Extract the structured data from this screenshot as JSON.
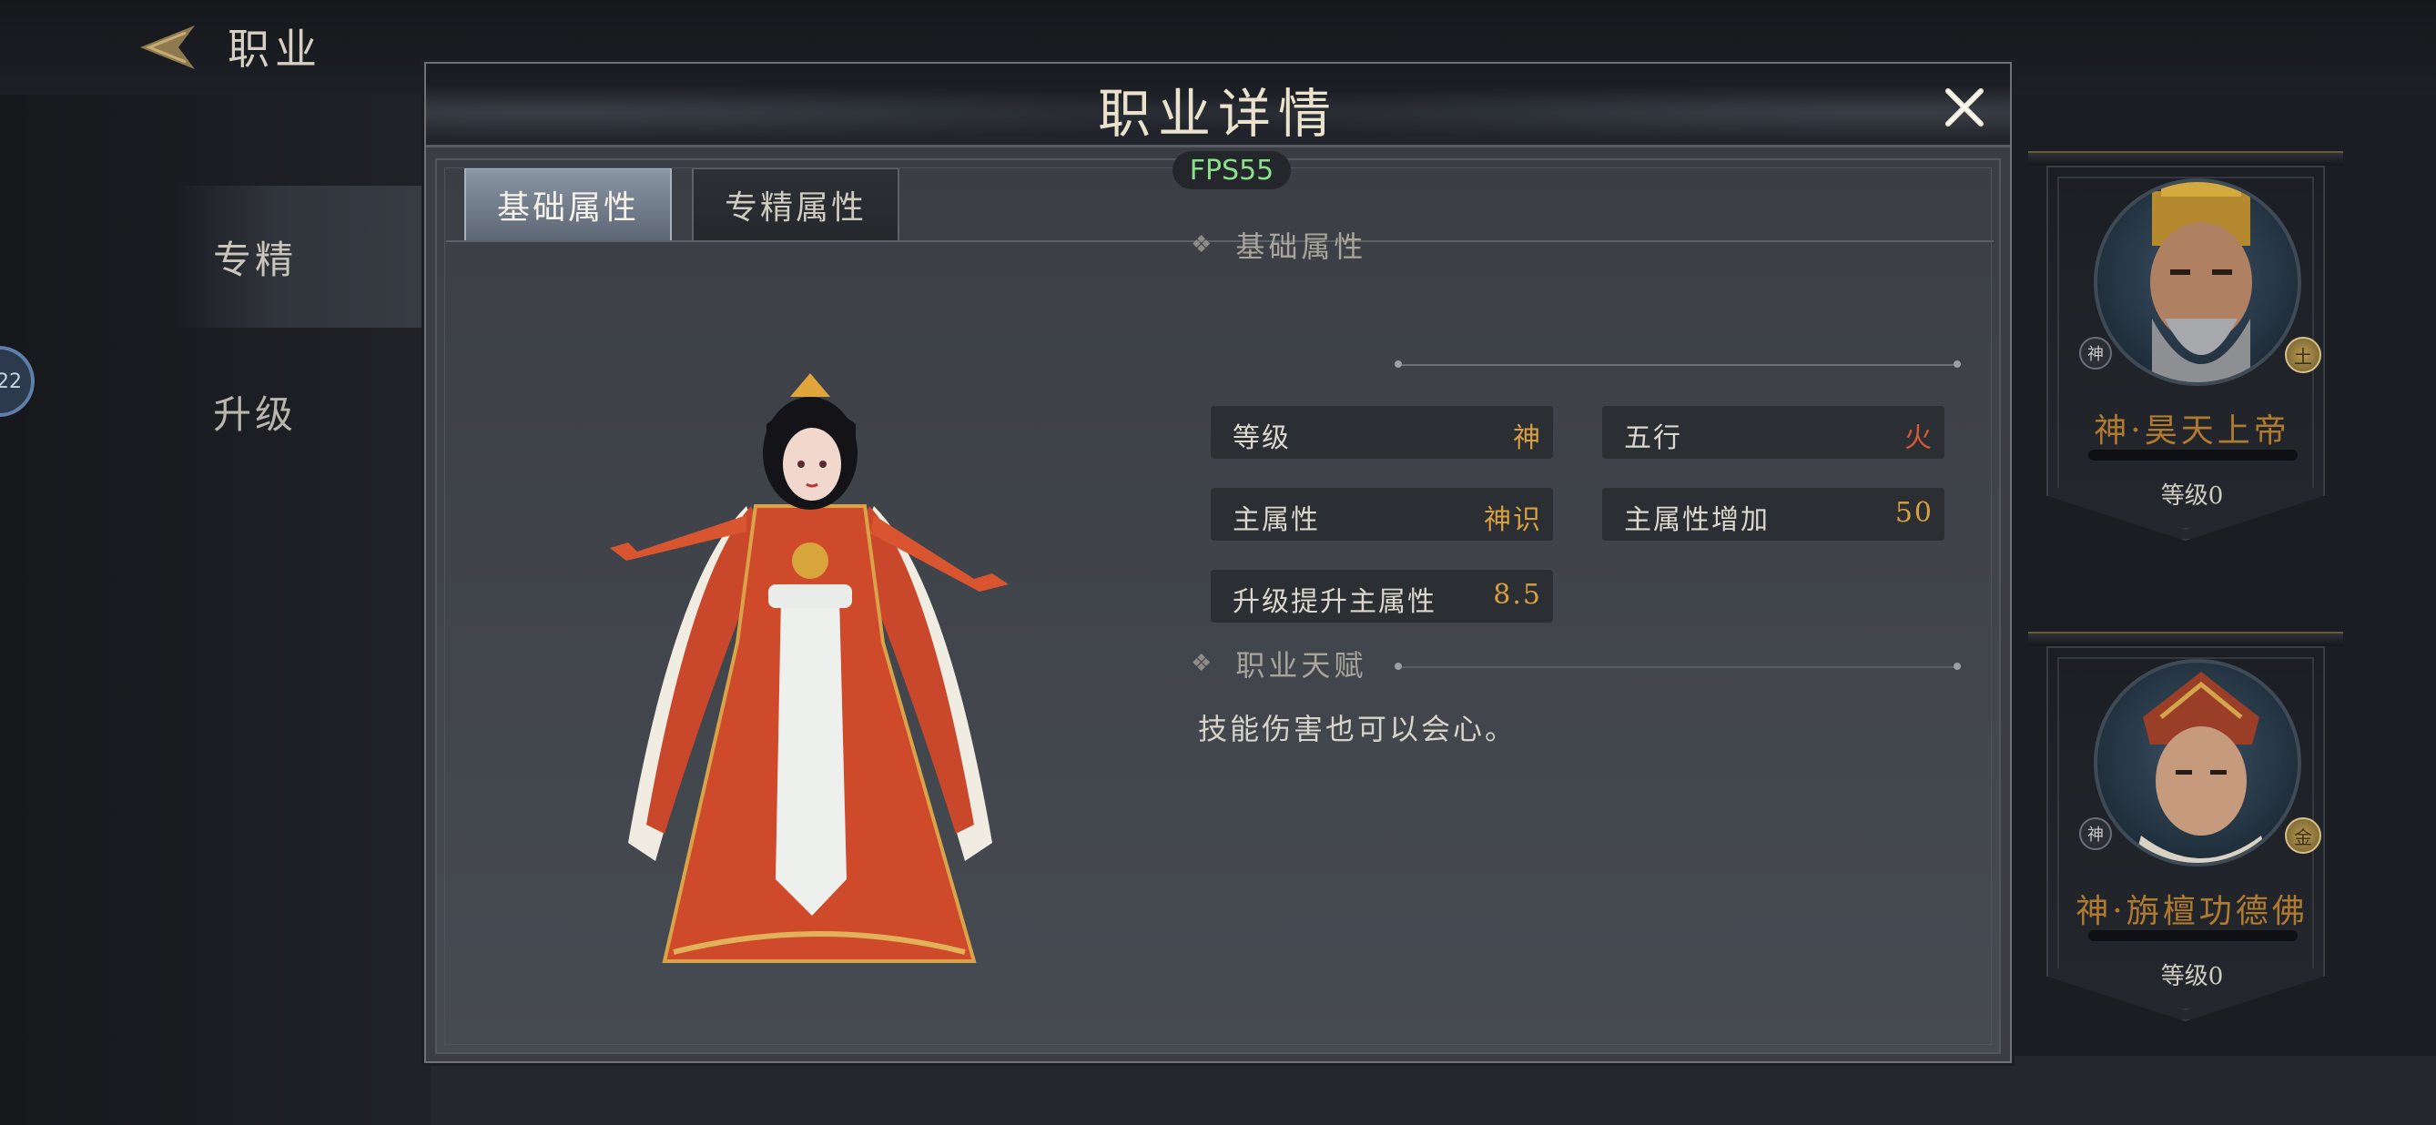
{
  "page": {
    "title": "职业",
    "left_menu": [
      "专精",
      "升级"
    ],
    "side_bubble": "22"
  },
  "cards": [
    {
      "name": "神·昊天上帝",
      "level": "等级0",
      "tag": "神",
      "element": "土"
    },
    {
      "name": "神·旃檀功德佛",
      "level": "等级0",
      "tag": "神",
      "element": "金"
    }
  ],
  "modal": {
    "title": "职业详情",
    "fps": "FPS55",
    "tabs": [
      "基础属性",
      "专精属性"
    ],
    "basic_section_title": "基础属性",
    "attributes": [
      {
        "label": "等级",
        "value": "神"
      },
      {
        "label": "五行",
        "value": "火"
      },
      {
        "label": "主属性",
        "value": "神识"
      },
      {
        "label": "主属性增加",
        "value": "50"
      },
      {
        "label": "升级提升主属性",
        "value": "8.5"
      }
    ],
    "talent_section_title": "职业天赋",
    "talent_text": "技能伤害也可以会心。"
  },
  "colors": {
    "value_gold": "#d8a040",
    "value_fire": "#d05a3a",
    "card_name": "#b07a2f",
    "fps_green": "#8ce08c"
  }
}
